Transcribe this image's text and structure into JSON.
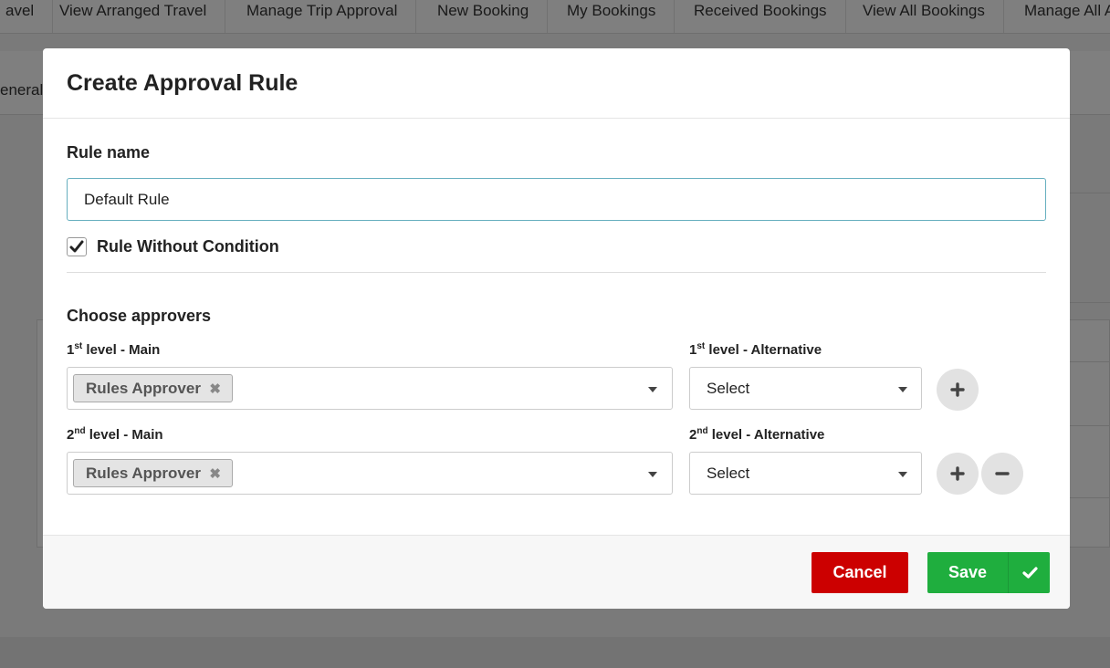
{
  "background": {
    "nav_items": [
      "avel",
      "View Arranged Travel",
      "Manage Trip Approval",
      "New Booking",
      "My Bookings",
      "Received Bookings",
      "View All Bookings",
      "Manage All A"
    ],
    "subbar_label": "eneral I"
  },
  "modal": {
    "title": "Create Approval Rule",
    "rule_name_label": "Rule name",
    "rule_name_value": "Default Rule",
    "rule_without_condition_label": "Rule Without Condition",
    "rule_without_condition_checked": true,
    "choose_approvers_label": "Choose approvers",
    "levels": [
      {
        "ordinal": "1",
        "ordinal_suffix": "st",
        "main_label": "level - Main",
        "alt_label": "level - Alternative",
        "main_tag": "Rules Approver",
        "alt_value": "Select"
      },
      {
        "ordinal": "2",
        "ordinal_suffix": "nd",
        "main_label": "level - Main",
        "alt_label": "level - Alternative",
        "main_tag": "Rules Approver",
        "alt_value": "Select"
      }
    ],
    "tag_remove_glyph": "✖",
    "footer": {
      "cancel_label": "Cancel",
      "save_label": "Save"
    }
  },
  "colors": {
    "cancel": "#cc0000",
    "save": "#1fae3e",
    "input_focus_border": "#66afbf",
    "overlay": "rgba(0,0,0,0.5)"
  }
}
